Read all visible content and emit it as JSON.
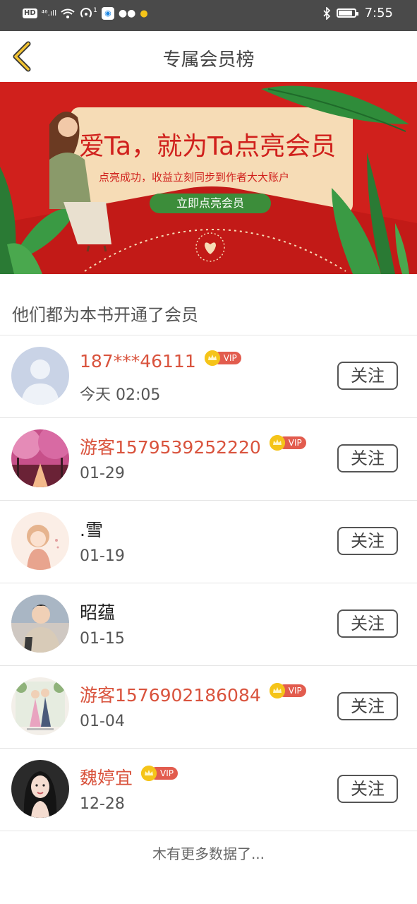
{
  "status_bar": {
    "hd": "HD",
    "signal": "⁴⁶.ıll",
    "app_badge": "1",
    "time": "7:55",
    "battery_level": 0.85
  },
  "nav": {
    "title": "专属会员榜"
  },
  "banner": {
    "headline": "爱Ta，就为Ta点亮会员",
    "subline": "点亮成功，收益立刻同步到作者大大账户",
    "cta": "立即点亮会员",
    "colors": {
      "background": "#d0201c",
      "card": "#f6dcb6",
      "leaf": "#2f8c3a",
      "cta": "#3c8d3a"
    }
  },
  "section": {
    "title": "他们都为本书开通了会员"
  },
  "members": [
    {
      "name": "187***46111",
      "vip": true,
      "date": "今天 02:05",
      "follow_label": "关注",
      "avatar": "default-avatar"
    },
    {
      "name": "游客1579539252220",
      "vip": true,
      "date": "01-29",
      "follow_label": "关注",
      "avatar": "cherry-blossom-photo"
    },
    {
      "name": ".雪",
      "vip": false,
      "date": "01-19",
      "follow_label": "关注",
      "avatar": "anime-girl-illustration"
    },
    {
      "name": "昭蕴",
      "vip": false,
      "date": "01-15",
      "follow_label": "关注",
      "avatar": "young-man-photo"
    },
    {
      "name": "游客1576902186084",
      "vip": true,
      "date": "01-04",
      "follow_label": "关注",
      "avatar": "wedding-photo"
    },
    {
      "name": "魏婷宜",
      "vip": true,
      "date": "12-28",
      "follow_label": "关注",
      "avatar": "woman-portrait-photo"
    }
  ],
  "vip_label": "VIP",
  "footer": "木有更多数据了...",
  "colors": {
    "vip_name": "#d9533d",
    "vip_badge": "#e25c4e",
    "crown": "#f5c419"
  }
}
